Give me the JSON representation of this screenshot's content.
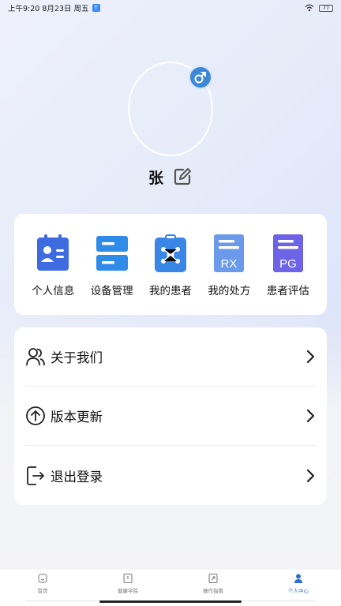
{
  "status_bar": {
    "time_date": "上午9:20 8月23日 周五",
    "notification_badge": "T",
    "battery": "77"
  },
  "profile": {
    "name": "张",
    "gender": "male"
  },
  "functions": [
    {
      "label": "个人信息",
      "icon": "id-card-icon",
      "color": "#3e6be0"
    },
    {
      "label": "设备管理",
      "icon": "device-manage-icon",
      "color": "#2f8be8"
    },
    {
      "label": "我的患者",
      "icon": "patients-clipboard-icon",
      "color": "#3a86e6"
    },
    {
      "label": "我的处方",
      "icon": "prescription-rx-icon",
      "color": "#5b8ee8"
    },
    {
      "label": "患者评估",
      "icon": "assessment-pg-icon",
      "color": "#6c63e6"
    }
  ],
  "menu": [
    {
      "label": "关于我们",
      "icon": "users-icon"
    },
    {
      "label": "版本更新",
      "icon": "upload-arrow-icon"
    },
    {
      "label": "退出登录",
      "icon": "logout-icon"
    }
  ],
  "bottom_nav": [
    {
      "label": "首页",
      "icon": "home-icon"
    },
    {
      "label": "健康学院",
      "icon": "book-icon"
    },
    {
      "label": "操作指南",
      "icon": "guide-icon"
    },
    {
      "label": "个人中心",
      "icon": "person-icon",
      "active": true
    }
  ],
  "colors": {
    "accent": "#2f6fd6",
    "card_bg": "#ffffff"
  }
}
